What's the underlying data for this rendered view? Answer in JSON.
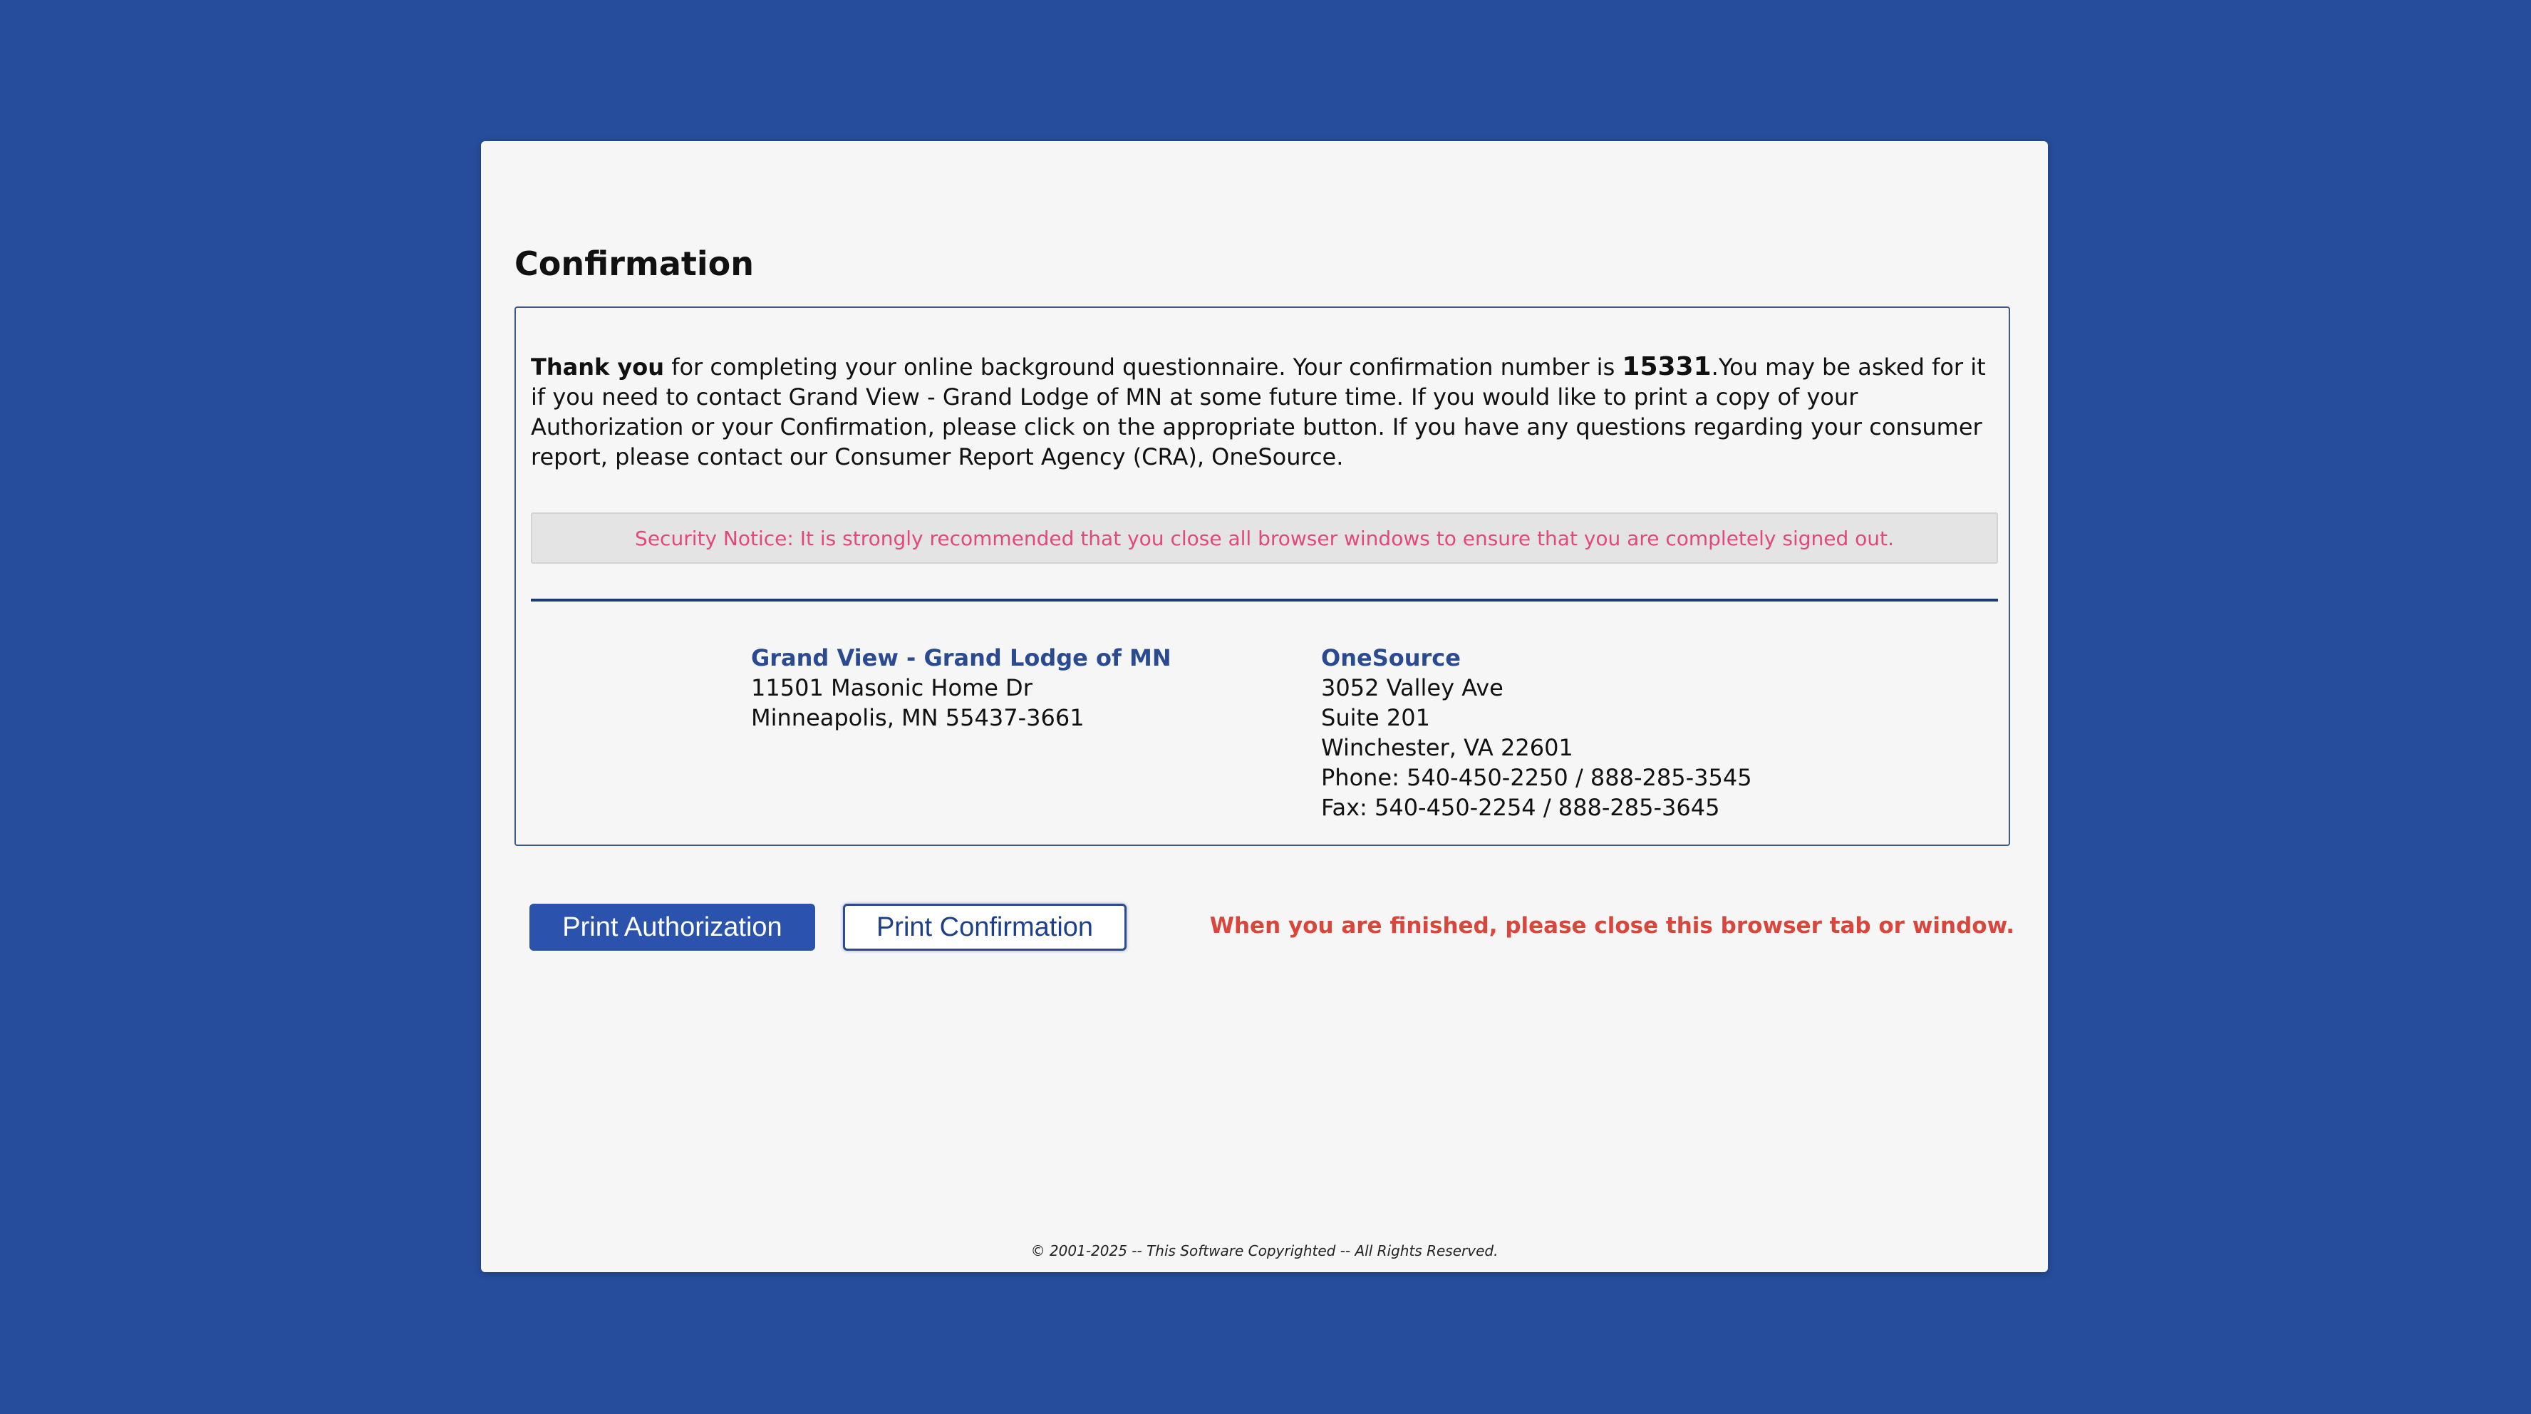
{
  "page": {
    "title": "Confirmation"
  },
  "message": {
    "thank_you": "Thank you",
    "part1": " for completing your online background questionnaire. Your confirmation number is ",
    "confirmation_number": "15331",
    "part2": ".You may be asked for it if you need to contact Grand View - Grand Lodge of MN at some future time. If you would like to print a copy of your Authorization or your Confirmation, please click on the appropriate button. If you have any questions regarding your consumer report, please contact our Consumer Report Agency (CRA), OneSource."
  },
  "security_notice": "Security Notice: It is strongly recommended that you close all browser windows to ensure that you are completely signed out.",
  "employer": {
    "name": "Grand View - Grand Lodge of MN",
    "lines": [
      "11501 Masonic Home Dr",
      "Minneapolis, MN 55437-3661"
    ]
  },
  "cra": {
    "name": "OneSource",
    "lines": [
      "3052 Valley Ave",
      "Suite 201",
      "Winchester, VA 22601",
      "Phone: 540-450-2250 / 888-285-3545",
      "Fax: 540-450-2254 / 888-285-3645"
    ]
  },
  "buttons": {
    "print_authorization": "Print Authorization",
    "print_confirmation": "Print Confirmation"
  },
  "finish_note": "When you are finished, please close this browser tab or window.",
  "footer": "© 2001-2025 -- This Software Copyrighted -- All Rights Reserved.",
  "colors": {
    "background": "#264d9b",
    "accent": "#2b53ad",
    "notice_text": "#e2487a",
    "warning_text": "#d9463b"
  }
}
